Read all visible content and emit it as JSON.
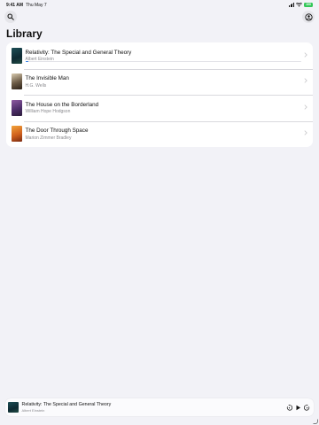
{
  "status_bar": {
    "time": "9:41 AM",
    "date": "Thu May 7",
    "battery": "100"
  },
  "header": {
    "title": "Library"
  },
  "library": {
    "books": [
      {
        "title": "Relativity: The Special and General Theory",
        "author": "Albert Einstein",
        "progress": 0.01
      },
      {
        "title": "The Invisible Man",
        "author": "H.G. Wells"
      },
      {
        "title": "The House on the Borderland",
        "author": "William Hope Hodgson"
      },
      {
        "title": "The Door Through Space",
        "author": "Marion Zimmer Bradley"
      }
    ]
  },
  "mini_player": {
    "title": "Relativity: The Special and General Theory",
    "author": "Albert Einstein"
  },
  "icons": {
    "search": "magnifyingglass-icon",
    "account": "person-circle-icon",
    "chevron": "chevron-right-icon",
    "skip_back": "gobackward-15-icon",
    "play": "play-icon",
    "skip_forward": "goforward-30-icon"
  },
  "colors": {
    "accent": "#2f7ee8",
    "battery": "#34c759",
    "background": "#f2f2f7"
  }
}
